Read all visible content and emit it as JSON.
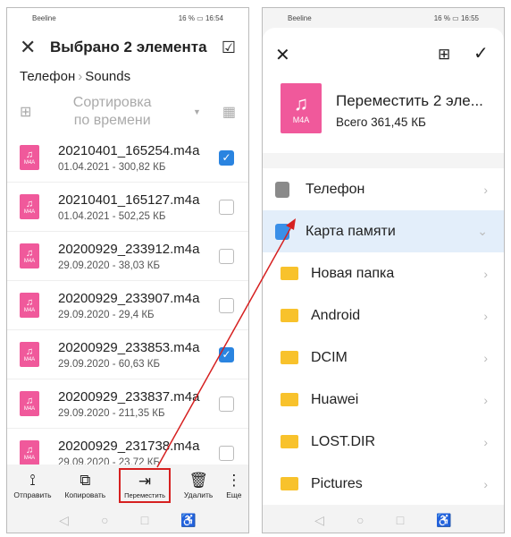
{
  "left": {
    "status": {
      "carrier": "Beeline",
      "battery": "16 %",
      "time": "16:54"
    },
    "title": "Выбрано 2 элемента",
    "breadcrumb": [
      "Телефон",
      "Sounds"
    ],
    "sort_label": "Сортировка по времени",
    "file_badge": "M4A",
    "files": [
      {
        "name": "20210401_165254.m4a",
        "meta": "01.04.2021 - 300,82 КБ",
        "checked": true
      },
      {
        "name": "20210401_165127.m4a",
        "meta": "01.04.2021 - 502,25 КБ",
        "checked": false
      },
      {
        "name": "20200929_233912.m4a",
        "meta": "29.09.2020 - 38,03 КБ",
        "checked": false
      },
      {
        "name": "20200929_233907.m4a",
        "meta": "29.09.2020 - 29,4 КБ",
        "checked": false
      },
      {
        "name": "20200929_233853.m4a",
        "meta": "29.09.2020 - 60,63 КБ",
        "checked": true
      },
      {
        "name": "20200929_233837.m4a",
        "meta": "29.09.2020 - 211,35 КБ",
        "checked": false
      },
      {
        "name": "20200929_231738.m4a",
        "meta": "29.09.2020 - 23,72 КБ",
        "checked": false
      }
    ],
    "actions": [
      "Отправить",
      "Копировать",
      "Переместить",
      "Удалить",
      "Еще"
    ]
  },
  "right": {
    "status": {
      "carrier": "Beeline",
      "battery": "16 %",
      "time": "16:55"
    },
    "move_title": "Переместить 2 эле...",
    "total": "Всего 361,45 КБ",
    "file_badge": "M4A",
    "locations": [
      "Телефон",
      "Карта памяти"
    ],
    "folders": [
      "Новая папка",
      "Android",
      "DCIM",
      "Huawei",
      "LOST.DIR",
      "Pictures"
    ]
  },
  "colors": {
    "accent": "#2a84e0",
    "file": "#f0599b",
    "folder": "#f8c22c",
    "annotation": "#d62020",
    "selected_bg": "#e3eefa"
  }
}
